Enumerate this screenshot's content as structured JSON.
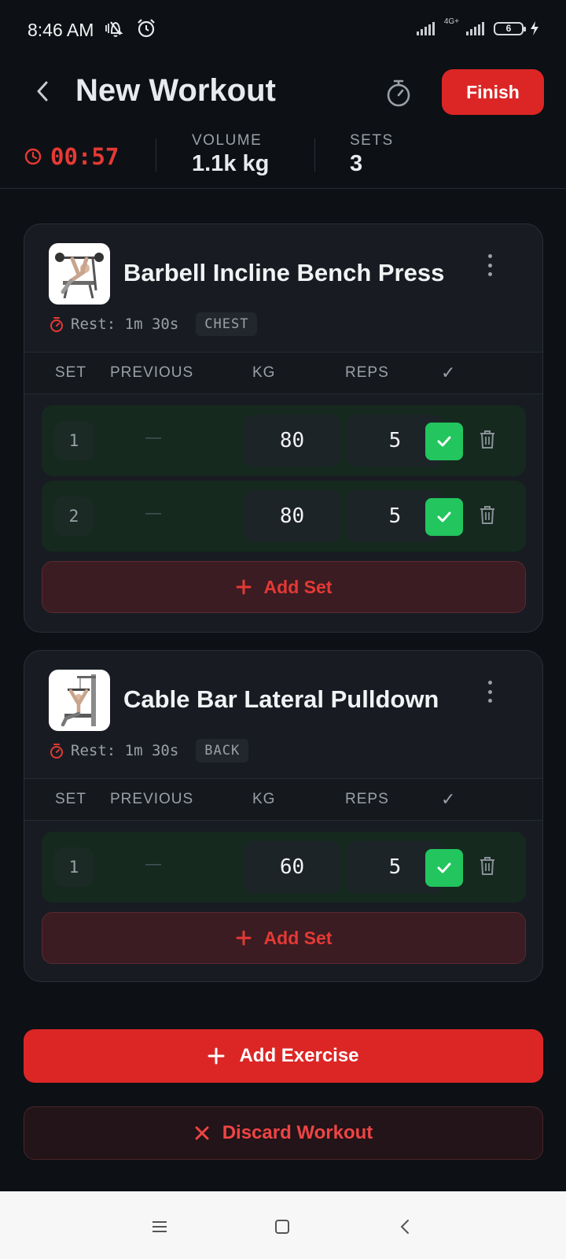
{
  "status_bar": {
    "time": "8:46 AM",
    "network": "4G+",
    "battery": "6"
  },
  "header": {
    "title": "New Workout",
    "finish_label": "Finish"
  },
  "stats": {
    "timer": "00:57",
    "volume_label": "VOLUME",
    "volume_value": "1.1k kg",
    "sets_label": "SETS",
    "sets_value": "3"
  },
  "table_headers": {
    "set": "SET",
    "previous": "PREVIOUS",
    "kg": "KG",
    "reps": "REPS",
    "done": "✓"
  },
  "exercises": [
    {
      "name": "Barbell Incline Bench Press",
      "rest": "Rest: 1m 30s",
      "muscle": "CHEST",
      "sets": [
        {
          "num": "1",
          "previous": "—",
          "kg": "80",
          "reps": "5",
          "done": true
        },
        {
          "num": "2",
          "previous": "—",
          "kg": "80",
          "reps": "5",
          "done": true
        }
      ],
      "add_set_label": "Add Set"
    },
    {
      "name": "Cable Bar Lateral Pulldown",
      "rest": "Rest: 1m 30s",
      "muscle": "BACK",
      "sets": [
        {
          "num": "1",
          "previous": "—",
          "kg": "60",
          "reps": "5",
          "done": true
        }
      ],
      "add_set_label": "Add Set"
    }
  ],
  "actions": {
    "add_exercise": "Add Exercise",
    "discard": "Discard Workout"
  },
  "colors": {
    "accent": "#dc2626",
    "success": "#22c55e",
    "background": "#0d1014"
  }
}
